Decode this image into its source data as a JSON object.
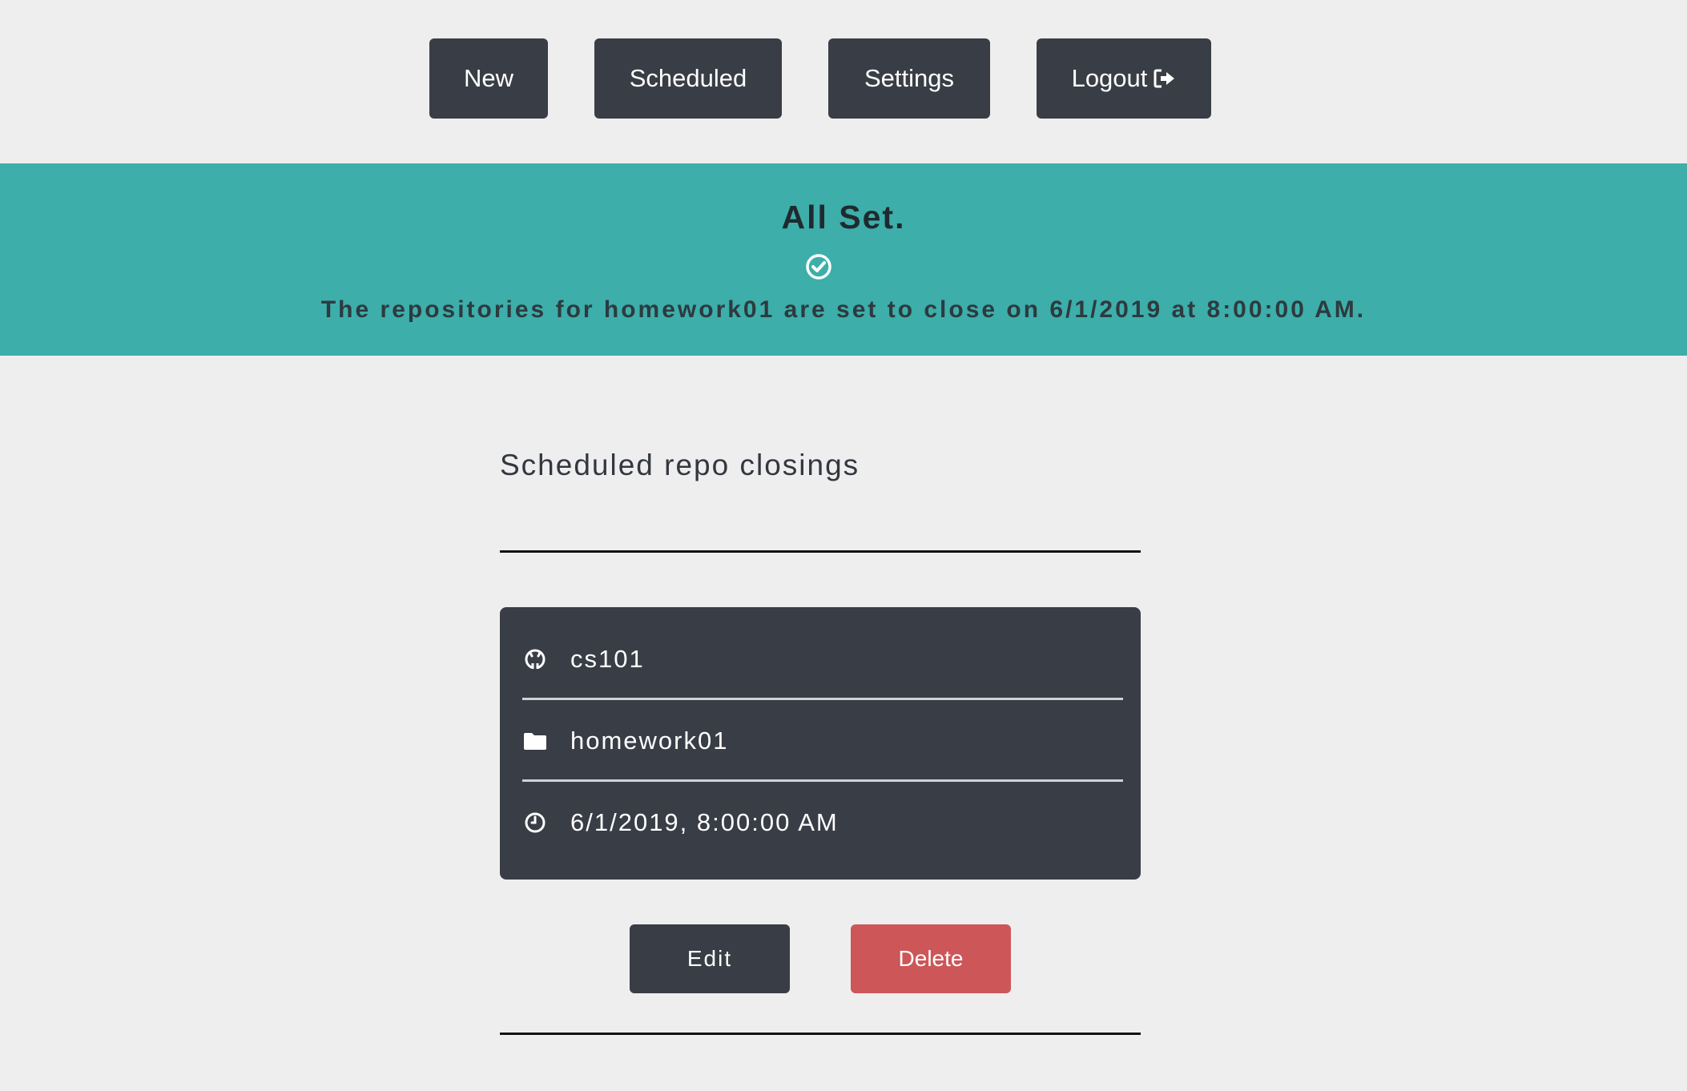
{
  "nav": {
    "new_label": "New",
    "scheduled_label": "Scheduled",
    "settings_label": "Settings",
    "logout_label": "Logout",
    "logout_icon": "sign-out-icon"
  },
  "banner": {
    "title": "All Set.",
    "icon": "check-circle-icon",
    "message": "The repositories for homework01 are set to close on 6/1/2019 at 8:00:00 AM."
  },
  "section": {
    "title": "Scheduled repo closings"
  },
  "closing": {
    "organization": "cs101",
    "assignment": "homework01",
    "datetime": "6/1/2019, 8:00:00 AM",
    "icons": [
      "github-icon",
      "folder-icon",
      "clock-icon"
    ]
  },
  "actions": {
    "edit_label": "Edit",
    "delete_label": "Delete"
  },
  "colors": {
    "background": "#eeeeee",
    "button_dark": "#393d46",
    "banner": "#3daeaa",
    "danger": "#cd5659"
  }
}
